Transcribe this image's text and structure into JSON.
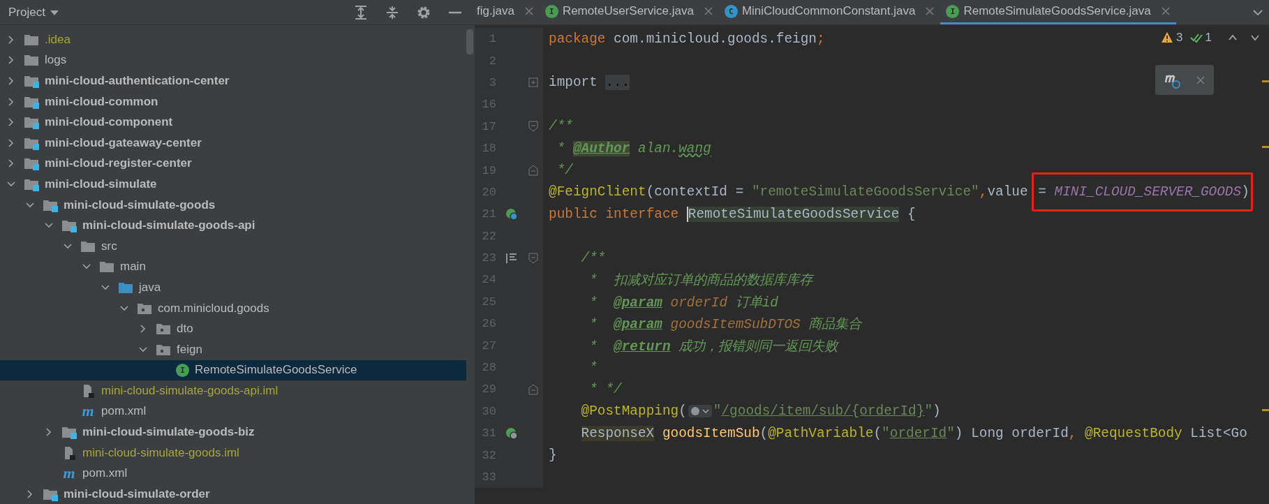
{
  "project_panel": {
    "title": "Project"
  },
  "tree": [
    {
      "label": ".idea",
      "kind": "folder",
      "ignored": true,
      "expanded": false,
      "selected": false
    },
    {
      "label": "logs",
      "kind": "folder",
      "expanded": false,
      "selected": false
    },
    {
      "label": "mini-cloud-authentication-center",
      "kind": "module",
      "expanded": false,
      "selected": false
    },
    {
      "label": "mini-cloud-common",
      "kind": "module",
      "expanded": false,
      "selected": false
    },
    {
      "label": "mini-cloud-component",
      "kind": "module",
      "expanded": false,
      "selected": false
    },
    {
      "label": "mini-cloud-gateaway-center",
      "kind": "module",
      "expanded": false,
      "selected": false
    },
    {
      "label": "mini-cloud-register-center",
      "kind": "module",
      "expanded": false,
      "selected": false
    },
    {
      "label": "mini-cloud-simulate",
      "kind": "module",
      "expanded": true,
      "selected": false,
      "children": [
        {
          "label": "mini-cloud-simulate-goods",
          "kind": "module",
          "expanded": true,
          "selected": false,
          "children": [
            {
              "label": "mini-cloud-simulate-goods-api",
              "kind": "module",
              "expanded": true,
              "selected": false,
              "children": [
                {
                  "label": "src",
                  "kind": "folder",
                  "expanded": true,
                  "selected": false,
                  "children": [
                    {
                      "label": "main",
                      "kind": "folder",
                      "expanded": true,
                      "selected": false,
                      "children": [
                        {
                          "label": "java",
                          "kind": "source",
                          "expanded": true,
                          "selected": false,
                          "children": [
                            {
                              "label": "com.minicloud.goods",
                              "kind": "package",
                              "expanded": true,
                              "selected": false,
                              "children": [
                                {
                                  "label": "dto",
                                  "kind": "package",
                                  "expanded": false,
                                  "selected": false
                                },
                                {
                                  "label": "feign",
                                  "kind": "package",
                                  "expanded": true,
                                  "selected": false,
                                  "children": [
                                    {
                                      "label": "RemoteSimulateGoodsService",
                                      "kind": "interface",
                                      "badge": "I",
                                      "selected": true
                                    }
                                  ]
                                }
                              ]
                            }
                          ]
                        }
                      ]
                    }
                  ]
                },
                {
                  "label": "mini-cloud-simulate-goods-api.iml",
                  "kind": "iml",
                  "ignored": true,
                  "selected": false
                },
                {
                  "label": "pom.xml",
                  "kind": "maven",
                  "badge": "m",
                  "selected": false
                }
              ]
            },
            {
              "label": "mini-cloud-simulate-goods-biz",
              "kind": "module",
              "expanded": false,
              "selected": false
            },
            {
              "label": "mini-cloud-simulate-goods.iml",
              "kind": "iml",
              "ignored": true,
              "selected": false
            },
            {
              "label": "pom.xml",
              "kind": "maven",
              "badge": "m",
              "selected": false
            }
          ]
        },
        {
          "label": "mini-cloud-simulate-order",
          "kind": "module",
          "expanded": false,
          "selected": false
        }
      ]
    }
  ],
  "tabs": [
    {
      "label": "fig.java",
      "selected": false
    },
    {
      "label": "RemoteUserService.java",
      "badge": "I",
      "kind": "interface",
      "selected": false
    },
    {
      "label": "MiniCloudCommonConstant.java",
      "badge": "C",
      "kind": "class",
      "selected": false
    },
    {
      "label": "RemoteSimulateGoodsService.java",
      "badge": "I",
      "kind": "interface",
      "selected": true
    }
  ],
  "inspections": {
    "warnings": "3",
    "weak_warnings": "1"
  },
  "lines": [
    {
      "number": "1",
      "tokens": [
        {
          "kind": "keyword",
          "text": "package "
        },
        {
          "kind": "plain",
          "text": "com.minicloud.goods.feign"
        },
        {
          "kind": "keyword",
          "text": ";"
        }
      ]
    },
    {
      "number": "2"
    },
    {
      "number": "3",
      "fold_marker": {
        "kind": "collapsed"
      },
      "stripe": true,
      "tokens": [
        {
          "kind": "plain",
          "text": "import "
        },
        {
          "kind": "folded",
          "text": "..."
        }
      ]
    },
    {
      "number": "16"
    },
    {
      "number": "17",
      "fold_marker": {
        "kind": "start"
      },
      "tokens": [
        {
          "kind": "comment",
          "text": "/**"
        }
      ]
    },
    {
      "number": "18",
      "stripe": true,
      "tokens": [
        {
          "kind": "comment",
          "text": " * "
        },
        {
          "kind": "doctag-marked",
          "text": "@Author"
        },
        {
          "kind": "comment",
          "text": " alan."
        },
        {
          "kind": "comment-typo",
          "text": "wang"
        }
      ]
    },
    {
      "number": "19",
      "fold_marker": {
        "kind": "end"
      },
      "tokens": [
        {
          "kind": "comment",
          "text": " */"
        }
      ]
    },
    {
      "number": "20",
      "tokens": [
        {
          "kind": "annotation",
          "text": "@FeignClient"
        },
        {
          "kind": "plain",
          "text": "(contextId = "
        },
        {
          "kind": "string",
          "text": "\"remoteSimulateGoodsService\""
        },
        {
          "kind": "keyword",
          "text": ","
        },
        {
          "kind": "plain",
          "text": "value "
        },
        {
          "kind": "plain",
          "text": "= ",
          "boxed": true
        },
        {
          "kind": "constant",
          "text": "MINI_CLOUD_SERVER_GOODS",
          "boxed": true
        },
        {
          "kind": "plain",
          "text": ")",
          "boxed": true
        }
      ]
    },
    {
      "number": "21",
      "gutter_marker": {
        "kind": "implemented"
      },
      "tokens": [
        {
          "kind": "keyword",
          "text": "public interface "
        },
        {
          "kind": "identifier-marked",
          "text": "RemoteSimulateGoodsService"
        },
        {
          "kind": "plain",
          "text": " {"
        }
      ]
    },
    {
      "number": "22"
    },
    {
      "number": "23",
      "gutter_marker": {
        "kind": "doc"
      },
      "fold_marker": {
        "kind": "start"
      },
      "tokens": [
        {
          "kind": "comment",
          "text": "    /**"
        }
      ]
    },
    {
      "number": "24",
      "tokens": [
        {
          "kind": "comment",
          "text": "     *  扣减对应订单的商品的数据库库存"
        }
      ]
    },
    {
      "number": "25",
      "tokens": [
        {
          "kind": "comment",
          "text": "     *  "
        },
        {
          "kind": "doctag",
          "text": "@param"
        },
        {
          "kind": "param",
          "text": " orderId"
        },
        {
          "kind": "comment",
          "text": " 订单id"
        }
      ]
    },
    {
      "number": "26",
      "tokens": [
        {
          "kind": "comment",
          "text": "     *  "
        },
        {
          "kind": "doctag",
          "text": "@param"
        },
        {
          "kind": "param",
          "text": " goodsItemSubDTOS"
        },
        {
          "kind": "comment",
          "text": " 商品集合"
        }
      ]
    },
    {
      "number": "27",
      "tokens": [
        {
          "kind": "comment",
          "text": "     *  "
        },
        {
          "kind": "doctag",
          "text": "@return"
        },
        {
          "kind": "comment",
          "text": " 成功，报错则同一返回失败"
        }
      ]
    },
    {
      "number": "28",
      "tokens": [
        {
          "kind": "comment",
          "text": "     *"
        }
      ]
    },
    {
      "number": "29",
      "fold_marker": {
        "kind": "end"
      },
      "tokens": [
        {
          "kind": "comment",
          "text": "     * */"
        }
      ]
    },
    {
      "number": "30",
      "stripe": true,
      "tokens": [
        {
          "kind": "annotation",
          "text": "    @PostMapping"
        },
        {
          "kind": "plain",
          "text": "("
        },
        {
          "kind": "inlay"
        },
        {
          "kind": "string",
          "text": "\""
        },
        {
          "kind": "string-link",
          "text": "/goods/item/sub/{orderId}"
        },
        {
          "kind": "string",
          "text": "\""
        },
        {
          "kind": "plain",
          "text": ")"
        }
      ]
    },
    {
      "number": "31",
      "gutter_marker": {
        "kind": "web"
      },
      "indented": true,
      "tokens": [
        {
          "kind": "type-marked",
          "text": "ResponseX"
        },
        {
          "kind": "method",
          "text": " goodsItemSub"
        },
        {
          "kind": "plain",
          "text": "("
        },
        {
          "kind": "annotation",
          "text": "@PathVariable"
        },
        {
          "kind": "plain",
          "text": "("
        },
        {
          "kind": "string",
          "text": "\""
        },
        {
          "kind": "string-link",
          "text": "orderId"
        },
        {
          "kind": "string",
          "text": "\""
        },
        {
          "kind": "plain",
          "text": ") Long orderId"
        },
        {
          "kind": "keyword",
          "text": ","
        },
        {
          "kind": "annotation",
          "text": " @RequestBody"
        },
        {
          "kind": "plain",
          "text": " List<Go"
        }
      ]
    },
    {
      "number": "32",
      "tokens": [
        {
          "kind": "plain",
          "text": "}"
        }
      ]
    },
    {
      "number": "33"
    }
  ]
}
